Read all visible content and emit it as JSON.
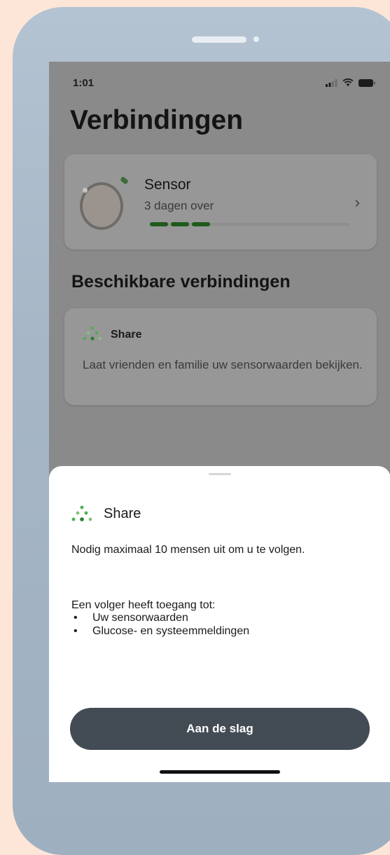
{
  "status_bar": {
    "time": "1:01",
    "icons": [
      "signal-icon",
      "wifi-icon",
      "battery-icon"
    ]
  },
  "page": {
    "title": "Verbindingen"
  },
  "sensor": {
    "name": "Sensor",
    "remaining": "3 dagen over",
    "progress": 0.3,
    "progress_segments": 3
  },
  "available": {
    "title": "Beschikbare verbindingen",
    "share_card": {
      "title": "Share",
      "description": "Laat vrienden en familie uw sensorwaarden bekijken."
    }
  },
  "sheet": {
    "title": "Share",
    "invite_text": "Nodig maximaal 10 mensen uit om u te volgen.",
    "access_title": "Een volger heeft toegang tot:",
    "bullet_symbol": "•",
    "access_items": [
      "Uw sensorwaarden",
      "Glucose- en systeemmeldingen"
    ],
    "button_label": "Aan de slag"
  },
  "colors": {
    "page_background": "#fde6d8",
    "button": "#434b55",
    "progress_fill": "#1f5a1c",
    "share_green": "#4caf50"
  }
}
